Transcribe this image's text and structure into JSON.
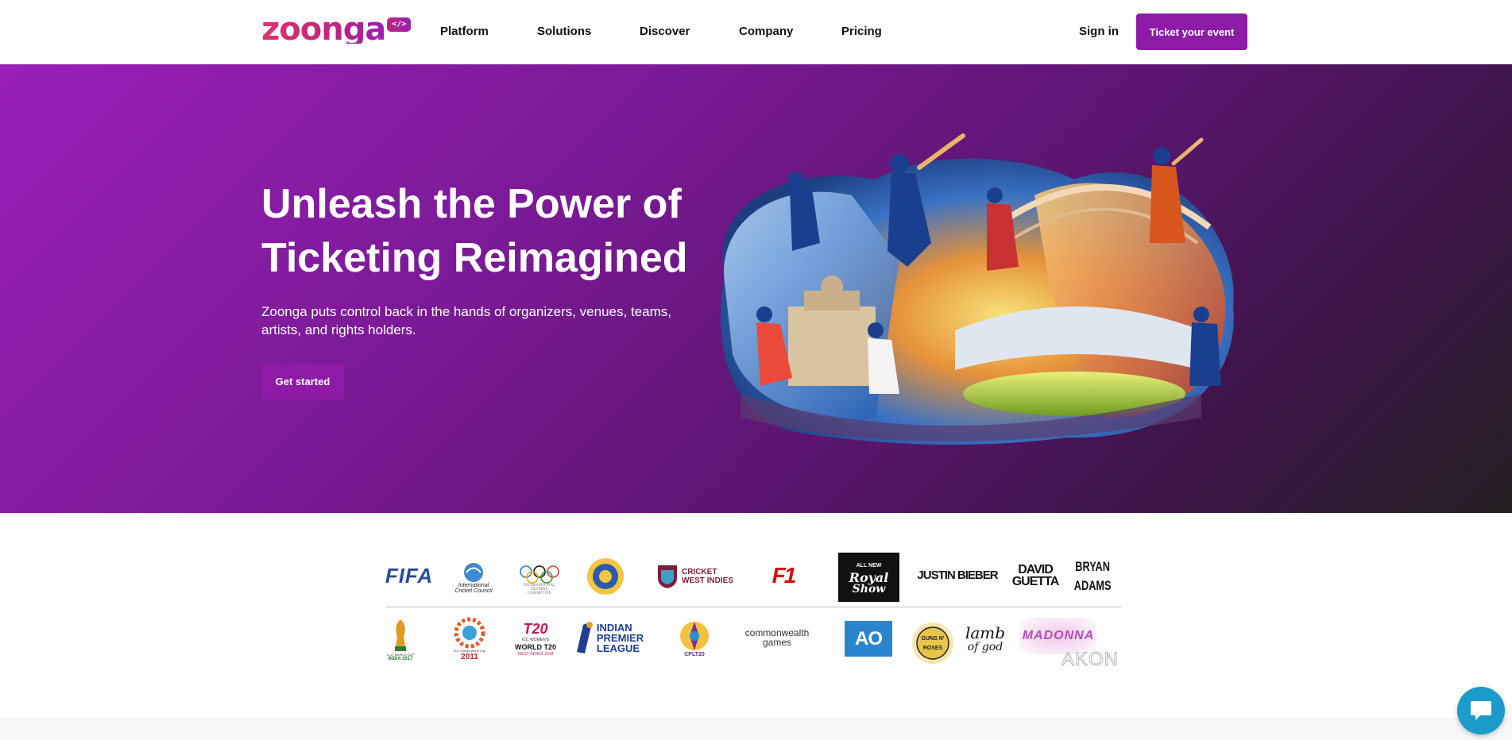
{
  "brand": {
    "logo_text": "zoonga",
    "logo_badge": "</>"
  },
  "nav": {
    "items": [
      "Platform",
      "Solutions",
      "Discover",
      "Company",
      "Pricing"
    ],
    "sign_in": "Sign in",
    "cta": "Ticket your event"
  },
  "hero": {
    "title_line1": "Unleash the Power of",
    "title_line2": "Ticketing Reimagined",
    "subtitle": "Zoonga puts control back in the hands of organizers, venues, teams, artists, and rights holders.",
    "button": "Get started"
  },
  "partners": {
    "row1": {
      "fifa": "FIFA",
      "icc": [
        "International",
        "Cricket Council"
      ],
      "olympic": [
        "INTERNATIONAL",
        "OLYMPIC",
        "COMMITTEE"
      ],
      "cwi": [
        "CRICKET",
        "WEST INDIES"
      ],
      "f1": "F1",
      "royal": [
        "ALL NEW",
        "Royal",
        "Show"
      ],
      "bieber": "JUSTIN BIEBER",
      "guetta": [
        "DAVID",
        "GUETTA"
      ],
      "adams": [
        "BRYAN",
        "ADAMS"
      ]
    },
    "row2": {
      "u17": [
        "U-17 WORLD CUP",
        "INDIA 2017"
      ],
      "icc2011": [
        "ICC Cricket World Cup",
        "2011"
      ],
      "t20women": [
        "T20",
        "ICC WOMEN'S",
        "WORLD T20",
        "WEST INDIES 2018"
      ],
      "ipl": [
        "INDIAN",
        "PREMIER",
        "LEAGUE"
      ],
      "cpl": "CPLT20",
      "commonwealth": [
        "commonwealth",
        "games"
      ],
      "ao": "AO",
      "gnr": [
        "GUNS N'",
        "ROSES"
      ],
      "lambofgod": [
        "lamb",
        "of god"
      ],
      "madonna": "MADONNA",
      "akon": "AKON"
    }
  },
  "colors": {
    "accent": "#8e1ba8",
    "chat": "#1a9bc9"
  },
  "icons": {
    "chat": "chat-bubble-icon"
  }
}
